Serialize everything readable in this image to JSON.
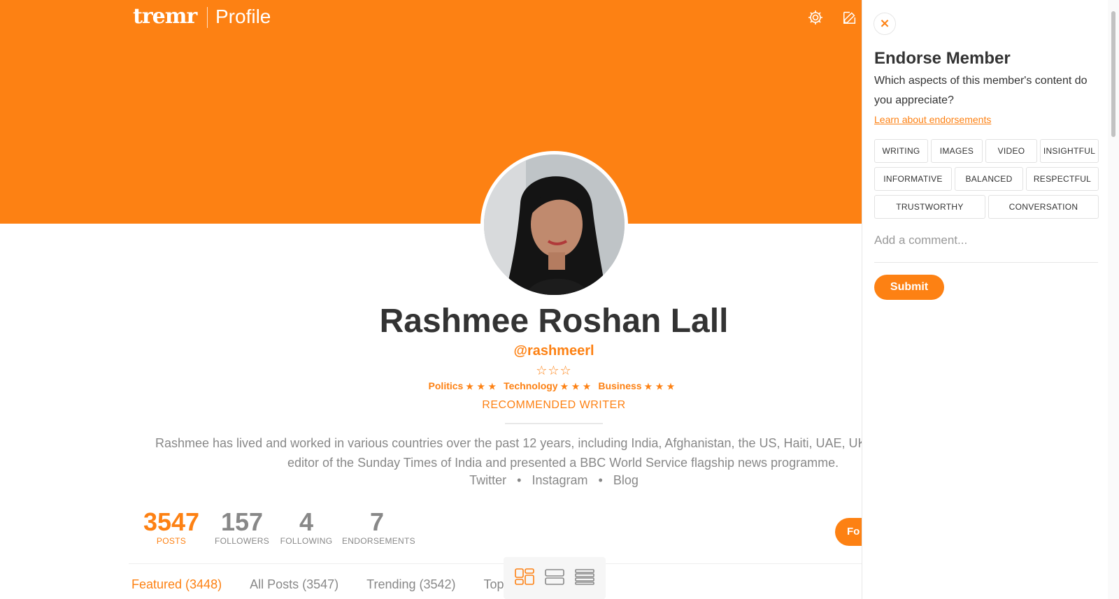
{
  "header": {
    "brand": "tremr",
    "section": "Profile",
    "icons": [
      "gear-icon",
      "edit-icon"
    ]
  },
  "profile": {
    "name": "Rashmee Roshan Lall",
    "handle": "@rashmeerl",
    "rank_stars": "☆☆☆",
    "rank_stars_count": 3,
    "topics": [
      {
        "label": "Politics",
        "stars": "★ ★ ★"
      },
      {
        "label": "Technology",
        "stars": "★ ★ ★"
      },
      {
        "label": "Business",
        "stars": "★ ★ ★"
      }
    ],
    "badge": "RECOMMENDED WRITER",
    "bio_line1": "Rashmee has lived and worked in various countries over the past 12 years, including India, Afghanistan, the US, Haiti, UAE, UK and",
    "bio_line2": "editor of the Sunday Times of India and presented a BBC World Service flagship news programme.",
    "links": [
      "Twitter",
      "Instagram",
      "Blog"
    ],
    "separator": "•"
  },
  "stats": [
    {
      "value": "3547",
      "label": "POSTS",
      "active": true
    },
    {
      "value": "157",
      "label": "FOLLOWERS",
      "active": false
    },
    {
      "value": "4",
      "label": "FOLLOWING",
      "active": false
    },
    {
      "value": "7",
      "label": "ENDORSEMENTS",
      "active": false
    }
  ],
  "follow_button": "Fo",
  "tabs": [
    {
      "label": "Featured (3448)",
      "active": true
    },
    {
      "label": "All Posts (3547)",
      "active": false
    },
    {
      "label": "Trending (3542)",
      "active": false
    },
    {
      "label": "Top",
      "active": false
    }
  ],
  "view_toggle": [
    "grid-view-icon",
    "card-view-icon",
    "list-view-icon"
  ],
  "panel": {
    "close": "×",
    "title": "Endorse Member",
    "description": "Which aspects of this member's content do you appreciate?",
    "link": "Learn about endorsements",
    "chips": [
      "WRITING",
      "IMAGES",
      "VIDEO",
      "INSIGHTFUL",
      "INFORMATIVE",
      "BALANCED",
      "RESPECTFUL",
      "TRUSTWORTHY",
      "CONVERSATION"
    ],
    "comment_placeholder": "Add a comment...",
    "submit": "Submit"
  },
  "colors": {
    "accent": "#fd8113",
    "text": "#333333",
    "muted": "#888888"
  }
}
